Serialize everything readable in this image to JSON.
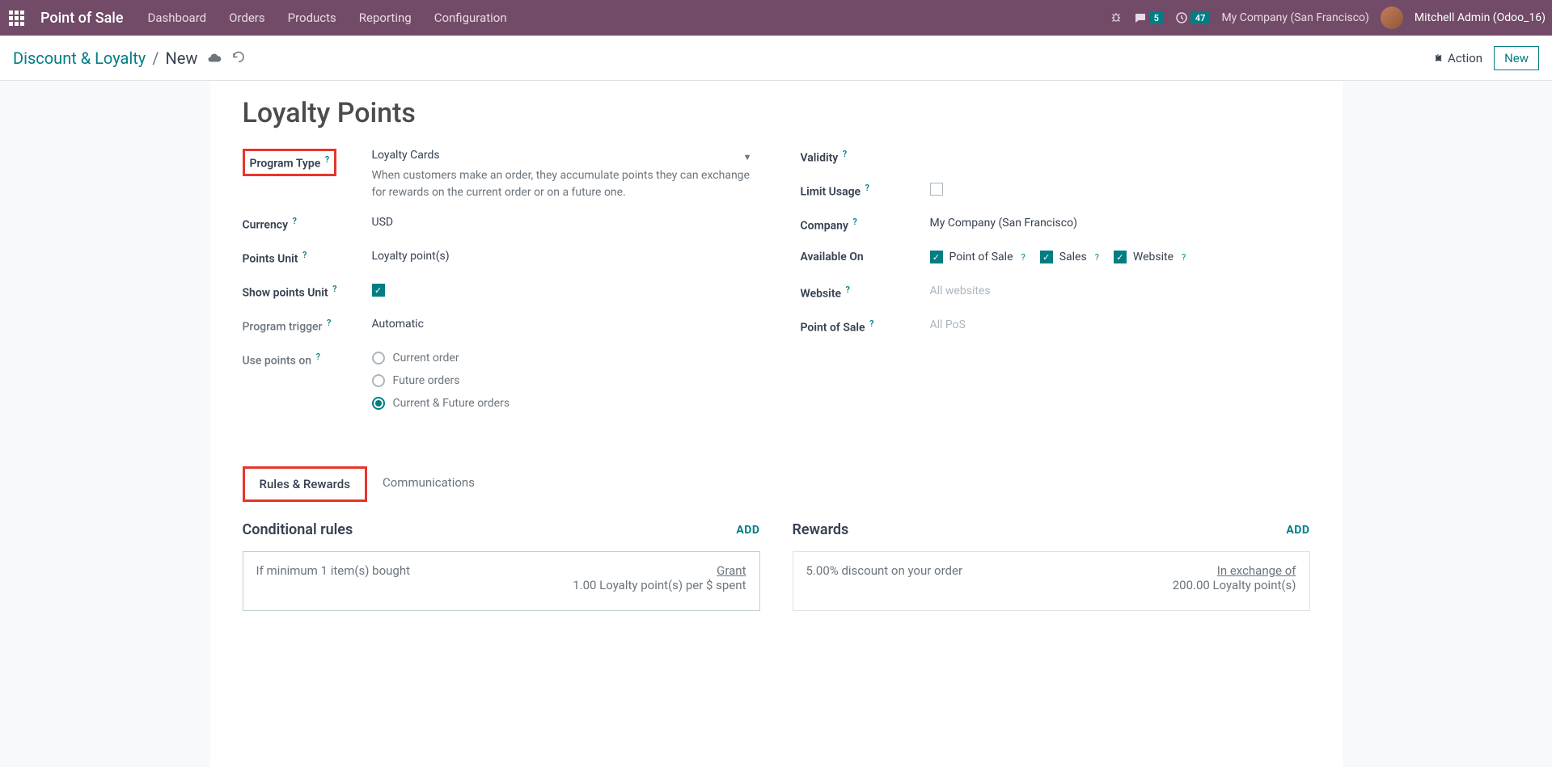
{
  "navbar": {
    "app_name": "Point of Sale",
    "links": [
      "Dashboard",
      "Orders",
      "Products",
      "Reporting",
      "Configuration"
    ],
    "chat_count": "5",
    "clock_count": "47",
    "company": "My Company (San Francisco)",
    "user": "Mitchell Admin (Odoo_16)"
  },
  "controlbar": {
    "breadcrumb_parent": "Discount & Loyalty",
    "breadcrumb_current": "New",
    "action_label": "Action",
    "new_label": "New"
  },
  "form": {
    "title": "Loyalty Points",
    "left": {
      "program_type": {
        "label": "Program Type",
        "value": "Loyalty Cards",
        "desc": "When customers make an order, they accumulate points they can exchange for rewards on the current order or on a future one."
      },
      "currency": {
        "label": "Currency",
        "value": "USD"
      },
      "points_unit": {
        "label": "Points Unit",
        "value": "Loyalty point(s)"
      },
      "show_points_unit": {
        "label": "Show points Unit"
      },
      "program_trigger": {
        "label": "Program trigger",
        "value": "Automatic"
      },
      "use_points_on": {
        "label": "Use points on",
        "options": [
          "Current order",
          "Future orders",
          "Current & Future orders"
        ]
      }
    },
    "right": {
      "validity": {
        "label": "Validity"
      },
      "limit_usage": {
        "label": "Limit Usage"
      },
      "company": {
        "label": "Company",
        "value": "My Company (San Francisco)"
      },
      "available_on": {
        "label": "Available On",
        "pos": "Point of Sale",
        "sales": "Sales",
        "website_opt": "Website"
      },
      "website": {
        "label": "Website",
        "placeholder": "All websites"
      },
      "pos": {
        "label": "Point of Sale",
        "placeholder": "All PoS"
      }
    }
  },
  "tabs": {
    "rules": "Rules & Rewards",
    "comms": "Communications"
  },
  "rules_rewards": {
    "cond_title": "Conditional rules",
    "rew_title": "Rewards",
    "add": "ADD",
    "rule_card": {
      "condition": "If minimum 1 item(s) bought",
      "grant_label": "Grant",
      "grant_value": "1.00 Loyalty point(s) per $ spent"
    },
    "reward_card": {
      "desc": "5.00% discount on your order",
      "exchange_label": "In exchange of",
      "exchange_value": "200.00 Loyalty point(s)"
    }
  }
}
